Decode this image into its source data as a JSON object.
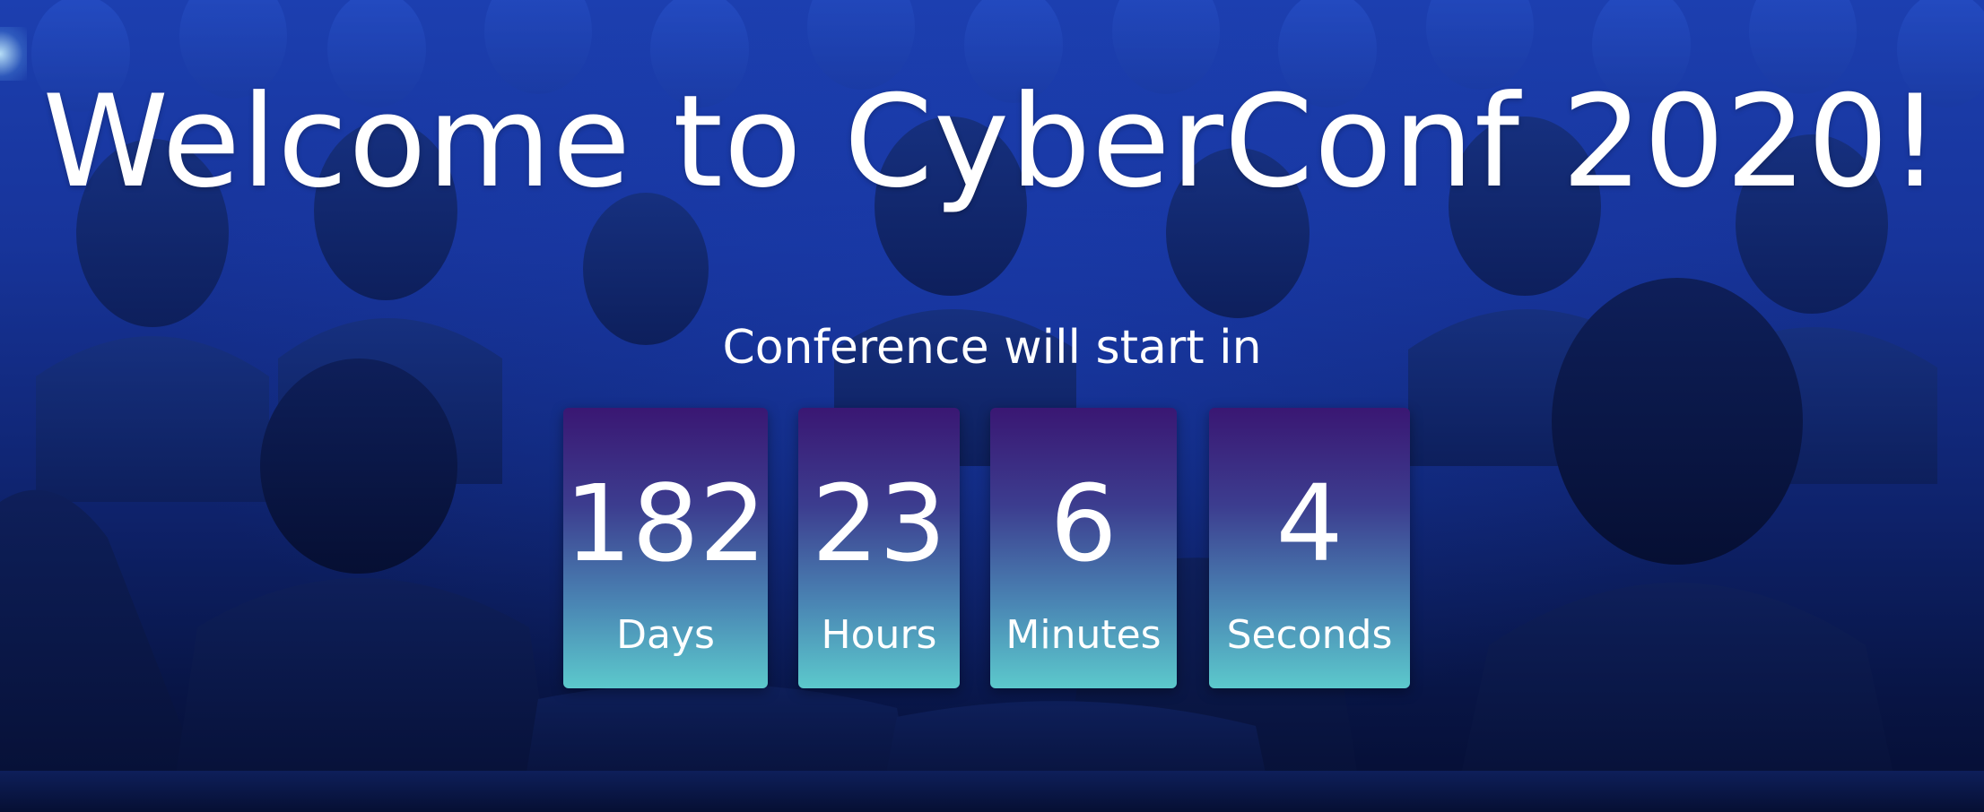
{
  "hero": {
    "title": "Welcome to CyberConf 2020!",
    "subtitle": "Conference will start in",
    "background": "audience-crowd-photo"
  },
  "countdown": {
    "days": {
      "value": "182",
      "label": "Days"
    },
    "hours": {
      "value": "23",
      "label": "Hours"
    },
    "minutes": {
      "value": "6",
      "label": "Minutes"
    },
    "seconds": {
      "value": "4",
      "label": "Seconds"
    }
  },
  "colors": {
    "box_top": "#3a1773",
    "box_bottom": "#5cc9cc",
    "background": "#1c3fb0",
    "text": "#ffffff"
  }
}
